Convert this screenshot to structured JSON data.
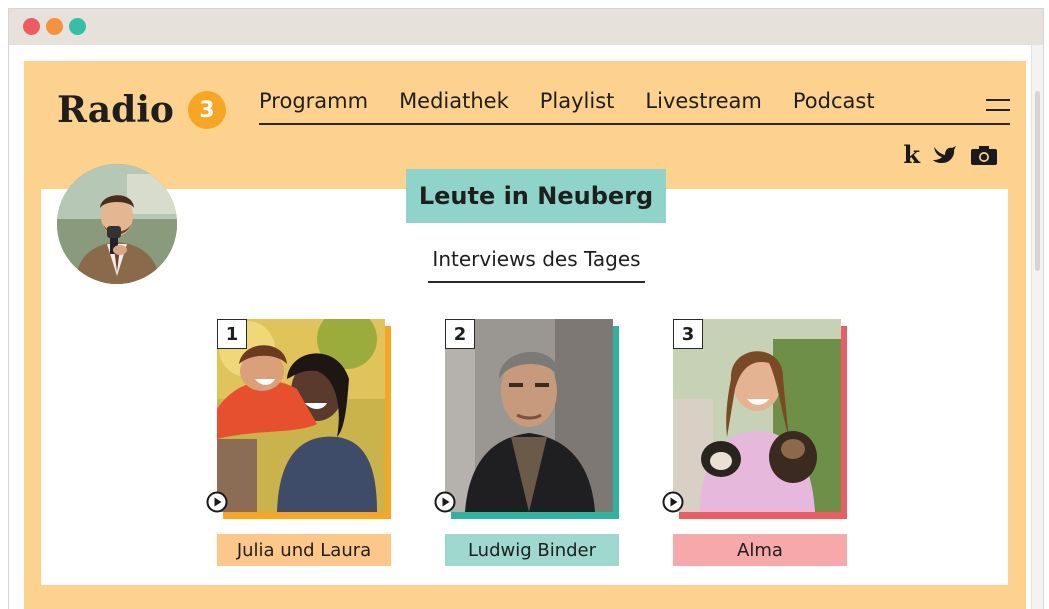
{
  "window": {
    "dots": [
      "#ef5b62",
      "#f6923b",
      "#34bfa6"
    ]
  },
  "site": {
    "logo_text": "Radio",
    "logo_badge": "3",
    "brand_color": "#fdd28f",
    "nav": [
      "Programm",
      "Mediathek",
      "Playlist",
      "Livestream",
      "Podcast"
    ],
    "social": {
      "k_label": "k",
      "icons": [
        "k-icon",
        "bird-icon",
        "camera-icon"
      ]
    }
  },
  "main": {
    "section_title": "Leute in Neuberg",
    "subtitle": "Interviews des Tages",
    "cards": [
      {
        "number": "1",
        "name": "Julia und Laura",
        "accent": "#f6a623",
        "label_bg": "#fcc88a"
      },
      {
        "number": "2",
        "name": "Ludwig Binder",
        "accent": "#2fb3a1",
        "label_bg": "#9fd8cf"
      },
      {
        "number": "3",
        "name": "Alma",
        "accent": "#ee5b62",
        "label_bg": "#f7a8aa"
      }
    ]
  }
}
